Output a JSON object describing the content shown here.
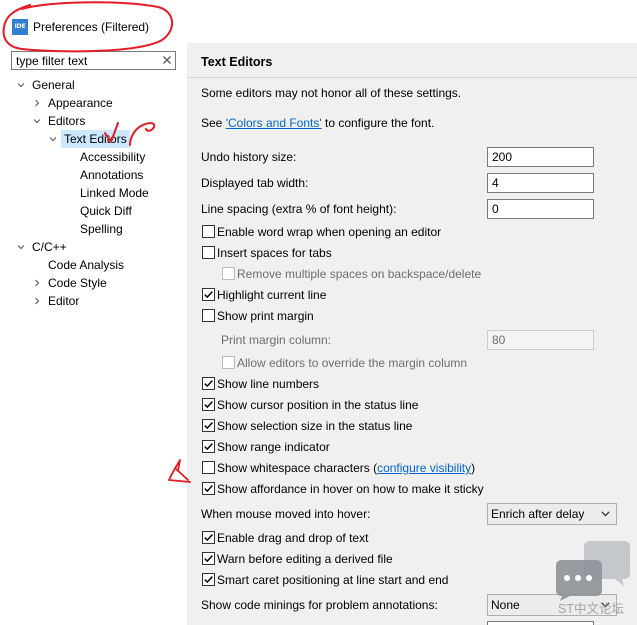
{
  "window": {
    "title": "Preferences (Filtered)",
    "icon_label": "IDE"
  },
  "filter": {
    "value": "type filter text"
  },
  "tree": [
    {
      "label": "General",
      "expanded": true,
      "children": [
        {
          "label": "Appearance",
          "expanded": false
        },
        {
          "label": "Editors",
          "expanded": true,
          "children": [
            {
              "label": "Text Editors",
              "expanded": true,
              "selected": true,
              "children": [
                {
                  "label": "Accessibility"
                },
                {
                  "label": "Annotations"
                },
                {
                  "label": "Linked Mode"
                },
                {
                  "label": "Quick Diff"
                },
                {
                  "label": "Spelling"
                }
              ]
            }
          ]
        }
      ]
    },
    {
      "label": "C/C++",
      "expanded": true,
      "children": [
        {
          "label": "Code Analysis"
        },
        {
          "label": "Code Style",
          "expanded": false
        },
        {
          "label": "Editor",
          "expanded": false
        }
      ]
    }
  ],
  "page": {
    "title": "Text Editors",
    "note": "Some editors may not honor all of these settings.",
    "fonts_hint": {
      "prefix": "See ",
      "link": "'Colors and Fonts'",
      "suffix": " to configure the font."
    },
    "undo_history_size": {
      "label": "Undo history size:",
      "value": "200"
    },
    "tab_width": {
      "label": "Displayed tab width:",
      "value": "4"
    },
    "line_spacing": {
      "label": "Line spacing (extra % of font height):",
      "value": "0"
    },
    "word_wrap": {
      "label": "Enable word wrap when opening an editor",
      "checked": false
    },
    "insert_spaces": {
      "label": "Insert spaces for tabs",
      "checked": false
    },
    "remove_spaces": {
      "label": "Remove multiple spaces on backspace/delete",
      "checked": false,
      "enabled": false
    },
    "highlight_line": {
      "label": "Highlight current line",
      "checked": true
    },
    "print_margin": {
      "label": "Show print margin",
      "checked": false
    },
    "print_margin_column": {
      "label": "Print margin column:",
      "value": "80",
      "enabled": false
    },
    "allow_override_margin": {
      "label": "Allow editors to override the margin column",
      "checked": false,
      "enabled": false
    },
    "line_numbers": {
      "label": "Show line numbers",
      "checked": true
    },
    "cursor_position": {
      "label": "Show cursor position in the status line",
      "checked": true
    },
    "selection_size": {
      "label": "Show selection size in the status line",
      "checked": true
    },
    "range_indicator": {
      "label": "Show range indicator",
      "checked": true
    },
    "whitespace": {
      "label": "Show whitespace characters (",
      "link": "configure visibility",
      "suffix": ")",
      "checked": false
    },
    "hover_affordance": {
      "label": "Show affordance in hover on how to make it sticky",
      "checked": true
    },
    "hover_mode": {
      "label": "When mouse moved into hover:",
      "value": "Enrich after delay"
    },
    "drag_drop": {
      "label": "Enable drag and drop of text",
      "checked": true
    },
    "derived_file_warning": {
      "label": "Warn before editing a derived file",
      "checked": true
    },
    "smart_caret": {
      "label": "Smart caret positioning at line start and end",
      "checked": true
    },
    "code_minings": {
      "label": "Show code minings for problem annotations:",
      "value": "None"
    }
  },
  "watermark": {
    "text": "ST中文论坛"
  },
  "icons": {
    "app": "ide-app-icon",
    "filter_clear": "close-icon",
    "tree_expanded": "chevron-down-icon",
    "tree_collapsed": "chevron-right-icon",
    "combo": "chevron-down-icon",
    "checkbox_checked": "check-icon",
    "watermark": "chat-bubbles-icon"
  },
  "colors": {
    "link": "#0066cc",
    "selection": "#cce8ff",
    "annotation": "#e41c23",
    "page_background": "#f0f0f0",
    "app_icon": "#2f7fd3",
    "watermark": "#a4a4a4"
  }
}
